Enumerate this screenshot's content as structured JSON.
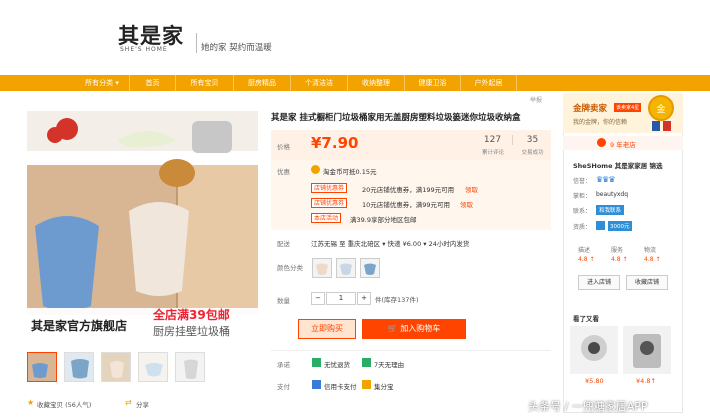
{
  "header": {
    "logo_cn": "其是家",
    "logo_en": "SHE'S HOME",
    "slogan": "她的家  契约而温暖"
  },
  "nav": {
    "items": [
      "所有分类 ▾",
      "首页",
      "所有宝贝",
      "厨房精品",
      "个清洁洁",
      "收纳整理",
      "健康卫浴",
      "户外起居"
    ]
  },
  "share_top": "举报",
  "gallery": {
    "banner_left": "其是家官方旗舰店",
    "banner_promo": "全店满39包邮",
    "banner_sub": "厨房挂壁垃圾桶",
    "favorite": "收藏宝贝 (56人气)",
    "share": "分享"
  },
  "product": {
    "title": "其是家 挂式橱柜门垃圾桶家用无盖厨房塑料垃圾篓迷你垃圾收纳盒",
    "price_label": "价格",
    "price": "¥7.90",
    "reviews_count": "127",
    "reviews_label": "累计评论",
    "sales_count": "35",
    "sales_label": "交易成功",
    "promo_label": "优惠",
    "tmall_coins": "淘金币可抵0.15元",
    "coupons": [
      {
        "tag": "店铺优惠券",
        "text": "20元店铺优惠券，满199元可用",
        "action": "领取"
      },
      {
        "tag": "店铺优惠券",
        "text": "10元店铺优惠券，满99元可用",
        "action": "领取"
      },
      {
        "tag": "本店活动",
        "text": "满39.9享部分地区包邮",
        "action": ""
      }
    ],
    "delivery_label": "配送",
    "delivery_text": "江苏无锡 至 重庆北碚区 ▾   快递 ¥6.00 ▾   24小时内发货",
    "color_label": "颜色分类",
    "qty_label": "数量",
    "qty_minus": "−",
    "qty_value": "1",
    "qty_plus": "+",
    "stock": "件(库存137件)",
    "buy_now": "立即购买",
    "add_cart": "加入购物车",
    "promise_label": "承诺",
    "promise_1": "无忧退货",
    "promise_2": "7天无理由",
    "pay_label": "支付",
    "pay_1": "信用卡支付",
    "pay_2": "集分宝"
  },
  "seller": {
    "badge_title": "金牌卖家",
    "badge_tag": "该卖家4星",
    "badge_sub": "我的金牌，你的信赖",
    "medal": "金",
    "years": "9 年老店",
    "shop_name": "SheSHome 其是家家居 锦选",
    "credit_label": "信誉：",
    "wangwang_label": "掌柜：",
    "wangwang_value": "beautyxdq",
    "contact_label": "联系：",
    "contact_value": "和我联系",
    "qual_label": "资质：",
    "deposit": "3000元",
    "ratings_desc": "描述",
    "ratings_service": "服务",
    "ratings_logistics": "物流",
    "score_desc": "4.8 ↑",
    "score_service": "4.8 ↑",
    "score_logistics": "4.8 ↑",
    "btn_enter": "进入店铺",
    "btn_fav": "收藏店铺",
    "also_like": "看了又看",
    "rec_price_1": "¥5.80",
    "rec_price_2": "¥4.8↑"
  },
  "watermark": "头条号 / 一兜糖家居APP",
  "colors": {
    "accent": "#f2a300",
    "price_red": "#ff4400"
  }
}
